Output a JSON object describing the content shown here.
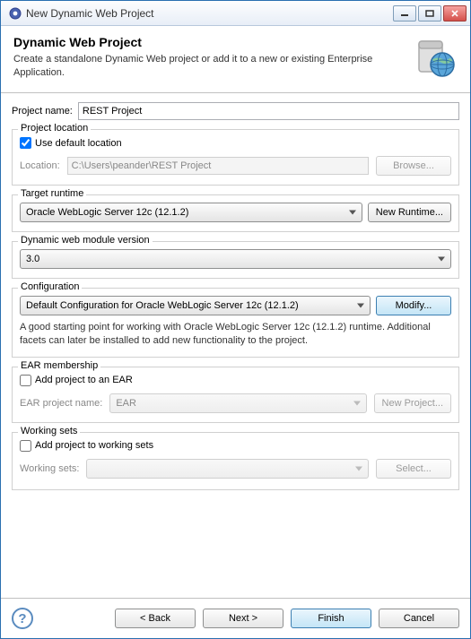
{
  "window": {
    "title": "New Dynamic Web Project"
  },
  "banner": {
    "title": "Dynamic Web Project",
    "description": "Create a standalone Dynamic Web project or add it to a new or existing Enterprise Application."
  },
  "project_name": {
    "label": "Project name:",
    "value": "REST Project"
  },
  "project_location": {
    "group_title": "Project location",
    "use_default_label": "Use default location",
    "use_default_checked": true,
    "location_label": "Location:",
    "location_value": "C:\\Users\\peander\\REST Project",
    "browse_label": "Browse..."
  },
  "target_runtime": {
    "group_title": "Target runtime",
    "value": "Oracle WebLogic Server 12c (12.1.2)",
    "new_runtime_label": "New Runtime..."
  },
  "module_version": {
    "group_title": "Dynamic web module version",
    "value": "3.0"
  },
  "configuration": {
    "group_title": "Configuration",
    "value": "Default Configuration for Oracle WebLogic Server 12c (12.1.2)",
    "modify_label": "Modify...",
    "description": "A good starting point for working with Oracle WebLogic Server 12c (12.1.2) runtime. Additional facets can later be installed to add new functionality to the project."
  },
  "ear": {
    "group_title": "EAR membership",
    "add_label": "Add project to an EAR",
    "add_checked": false,
    "name_label": "EAR project name:",
    "name_value": "EAR",
    "new_project_label": "New Project..."
  },
  "working_sets": {
    "group_title": "Working sets",
    "add_label": "Add project to working sets",
    "add_checked": false,
    "sets_label": "Working sets:",
    "sets_value": "",
    "select_label": "Select..."
  },
  "footer": {
    "back": "< Back",
    "next": "Next >",
    "finish": "Finish",
    "cancel": "Cancel"
  }
}
